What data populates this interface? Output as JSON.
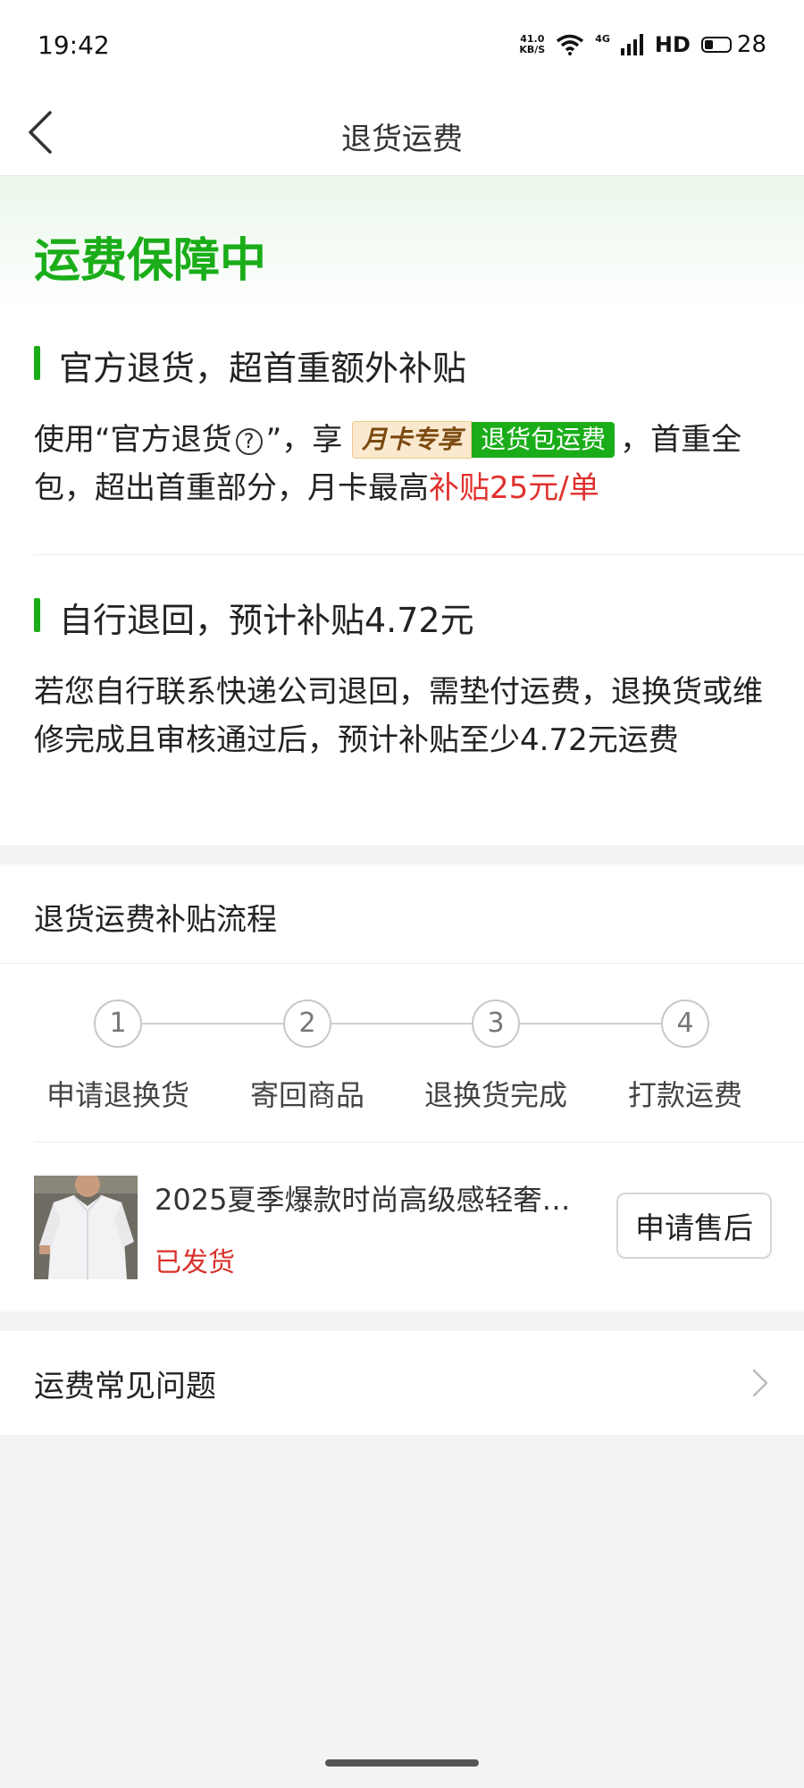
{
  "status_bar": {
    "time": "19:42",
    "net_speed_value": "41.0",
    "net_speed_unit": "KB/S",
    "network_type": "4G",
    "hd_label": "HD",
    "battery_level": "28"
  },
  "nav": {
    "title": "退货运费",
    "back_icon": "chevron-left-icon"
  },
  "guarantee": {
    "heading": "运费保障中",
    "official": {
      "title": "官方退货，超首重额外补贴",
      "text_prefix": "使用“官方退货",
      "help_icon": "?",
      "text_mid": "”，享",
      "badge_month": "月卡专享",
      "badge_free": "退货包运费",
      "text_suffix": "，首重全包，超出首重部分，月卡最高",
      "highlight": "补贴25元/单"
    },
    "self_return": {
      "title": "自行退回，预计补贴4.72元",
      "text": "若您自行联系快递公司退回，需垫付运费，退换货或维修完成且审核通过后，预计补贴至少4.72元运费"
    }
  },
  "process": {
    "title": "退货运费补贴流程",
    "steps": [
      {
        "number": "1",
        "label": "申请退换货"
      },
      {
        "number": "2",
        "label": "寄回商品"
      },
      {
        "number": "3",
        "label": "退换货完成"
      },
      {
        "number": "4",
        "label": "打款运费"
      }
    ],
    "product": {
      "name": "2025夏季爆款时尚高级感轻奢…",
      "status": "已发货",
      "button": "申请售后"
    }
  },
  "faq": {
    "label": "运费常见问题",
    "chevron_icon": "chevron-right-icon"
  },
  "colors": {
    "accent_green": "#1aad19",
    "highlight_red": "#e0302c"
  }
}
